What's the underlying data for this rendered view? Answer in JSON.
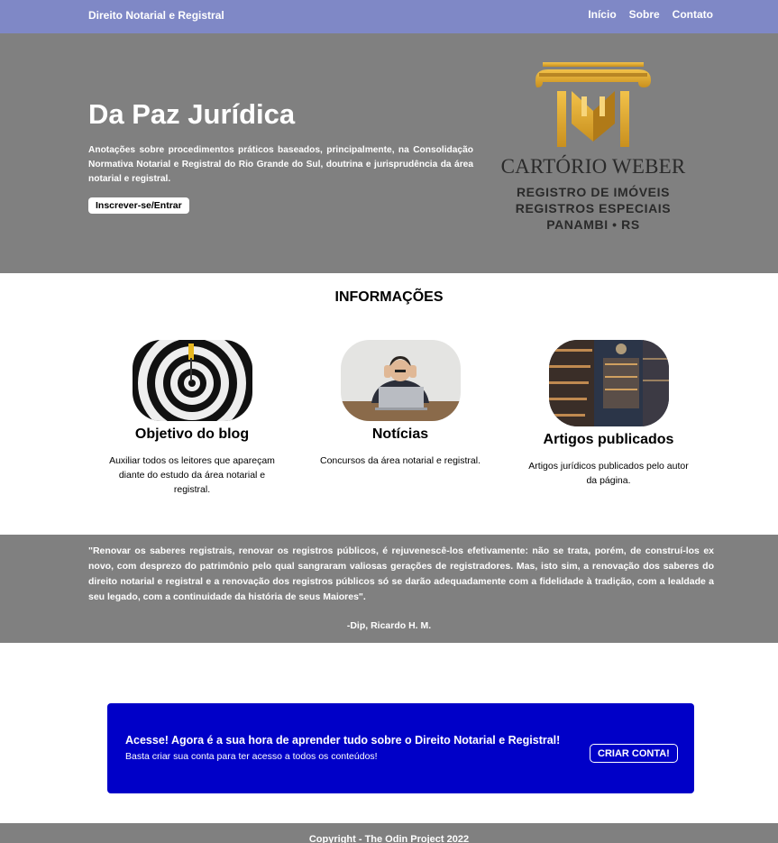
{
  "header": {
    "brand": "Direito Notarial e Registral",
    "nav": [
      "Início",
      "Sobre",
      "Contato"
    ]
  },
  "hero": {
    "title": "Da Paz Jurídica",
    "description": "Anotações sobre procedimentos práticos baseados, principalmente, na Consolidação Normativa Notarial e Registral do Rio Grande do Sul, doutrina e jurisprudência da área notarial e registral.",
    "button": "Inscrever-se/Entrar",
    "logo": {
      "line1": "CARTÓRIO WEBER",
      "line2": "REGISTRO DE IMÓVEIS",
      "line3": "REGISTROS ESPECIAIS",
      "line4": "PANAMBI • RS",
      "color_gold": "#d9a232",
      "color_text": "#2a2a2a"
    }
  },
  "info": {
    "title": "INFORMAÇÕES",
    "cards": [
      {
        "title": "Objetivo do blog",
        "text": "Auxiliar todos os leitores que apareçam diante do estudo da área notarial e registral.",
        "image": "target-dartboard-image"
      },
      {
        "title": "Notícias",
        "text": "Concursos da área notarial e registral.",
        "image": "stressed-man-laptop-image"
      },
      {
        "title": "Artigos publicados",
        "text": "Artigos jurídicos publicados pelo autor da página.",
        "image": "library-bookshelves-image"
      }
    ]
  },
  "quote": {
    "text": "\"Renovar os saberes registrais, renovar os registros públicos, é rejuvenescê-los efetivamente: não se trata, porém, de construí-los ex novo, com desprezo do patrimônio pelo qual sangraram valiosas gerações de registradores. Mas, isto sim, a renovação dos saberes do direito notarial e registral e a renovação dos registros públicos só se darão adequadamente com a fidelidade à tradição, com a lealdade a seu legado, com a continuidade da história de seus Maiores\".",
    "author": "-Dip, Ricardo H. M."
  },
  "cta": {
    "title": "Acesse! Agora é a sua hora de aprender tudo sobre o Direito Notarial e Registral!",
    "subtitle": "Basta criar sua conta para ter acesso a todos os conteúdos!",
    "button": "CRIAR CONTA!"
  },
  "footer": {
    "text": "Copyright - The Odin Project 2022"
  },
  "colors": {
    "header_bg": "#7f88c6",
    "hero_bg": "#808080",
    "cta_bg": "#0000c8"
  }
}
